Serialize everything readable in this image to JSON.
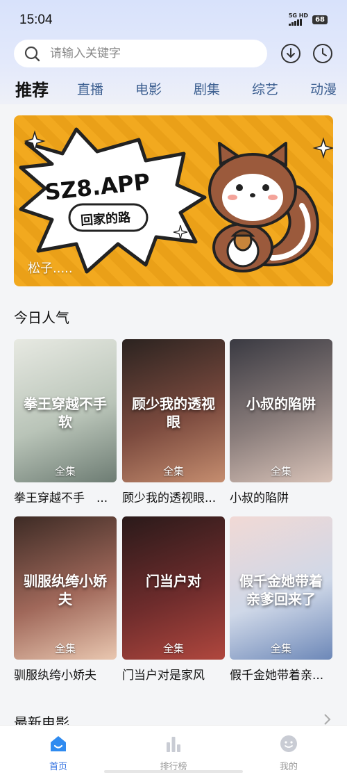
{
  "status_bar": {
    "time": "15:04",
    "network": "5G HD",
    "battery": "68"
  },
  "search": {
    "placeholder": "请输入关键字"
  },
  "header_icons": [
    "download-icon",
    "history-clock-icon"
  ],
  "tabs": [
    {
      "label": "推荐",
      "active": true
    },
    {
      "label": "直播",
      "active": false
    },
    {
      "label": "电影",
      "active": false
    },
    {
      "label": "剧集",
      "active": false
    },
    {
      "label": "综艺",
      "active": false
    },
    {
      "label": "动漫",
      "active": false
    }
  ],
  "banner": {
    "headline": "SZ8.APP",
    "tagline": "回家的路",
    "caption": "松子....."
  },
  "sections": {
    "popular_title": "今日人气",
    "latest_movies_title": "最新电影"
  },
  "popular_items": [
    {
      "title": "拳王穿越不手　...",
      "badge": "全集",
      "poster_text": "拳王穿越不手软",
      "colors": [
        "#e7e9e2",
        "#b9c4b8",
        "#6d7c73"
      ]
    },
    {
      "title": "顾少我的透视眼...",
      "badge": "全集",
      "poster_text": "顾少我的透视眼",
      "colors": [
        "#2b2320",
        "#7b4a3e",
        "#c58d6f"
      ]
    },
    {
      "title": "小叔的陷阱",
      "badge": "全集",
      "poster_text": "小叔的陷阱",
      "colors": [
        "#3a3a42",
        "#8a7d7b",
        "#d9c3b8"
      ]
    },
    {
      "title": "驯服纨绔小娇夫",
      "badge": "全集",
      "poster_text": "驯服纨绔小娇夫",
      "colors": [
        "#3d2b25",
        "#a0685a",
        "#e9c7b0"
      ]
    },
    {
      "title": "门当户对是家风",
      "badge": "全集",
      "poster_text": "门当户对",
      "colors": [
        "#2a1a1a",
        "#6e2c2c",
        "#b0473e"
      ]
    },
    {
      "title": "假千金她带着亲...",
      "badge": "全集",
      "poster_text": "假千金她带着亲爹回来了",
      "colors": [
        "#f1d9d5",
        "#cfd8e8",
        "#6d88b8"
      ]
    }
  ],
  "bottom_nav": [
    {
      "label": "首页",
      "icon": "home-icon",
      "active": true
    },
    {
      "label": "排行榜",
      "icon": "ranking-chart-icon",
      "active": false
    },
    {
      "label": "我的",
      "icon": "profile-face-icon",
      "active": false
    }
  ],
  "colors": {
    "accent": "#2f6fe0",
    "tab_inactive": "#3a5d8f",
    "banner_orange": "#f2a91f"
  }
}
